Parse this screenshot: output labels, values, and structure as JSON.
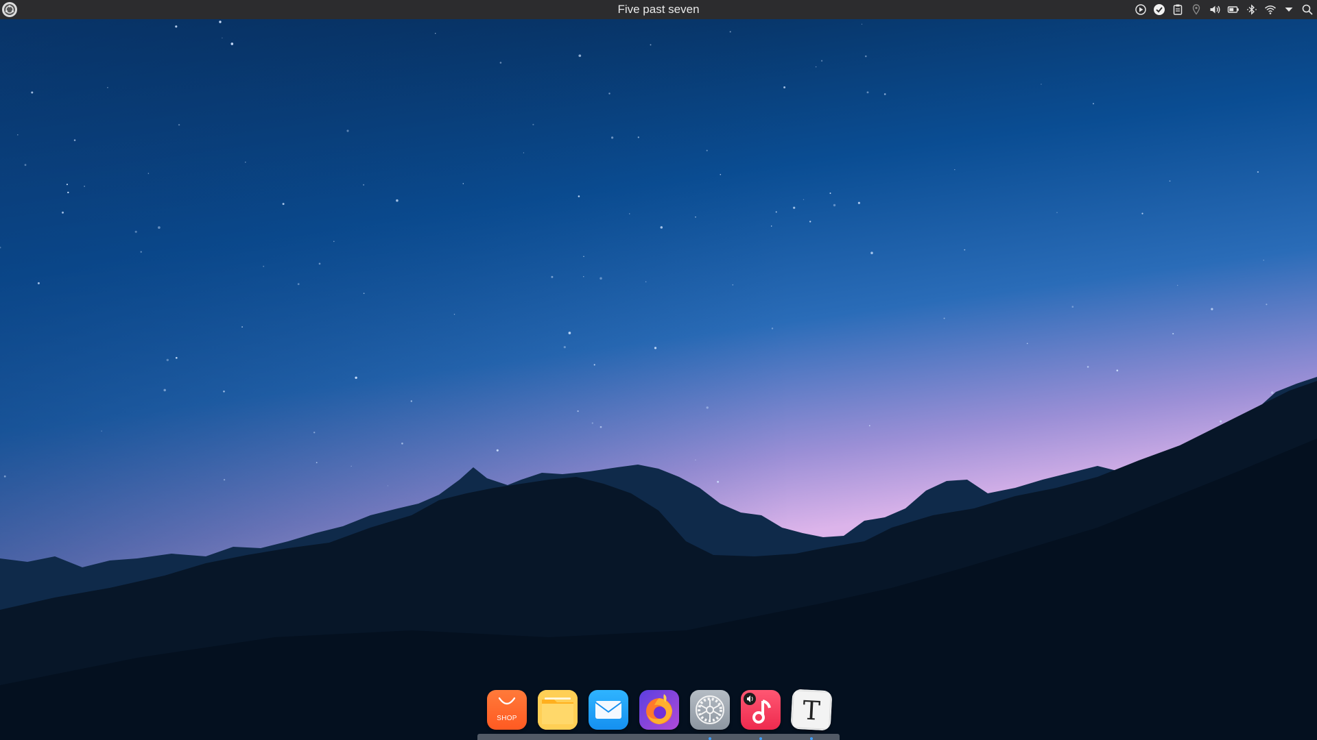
{
  "topbar": {
    "clock_text": "Five past seven",
    "menu_icon": "distro-logo-icon",
    "tray_icons": [
      "media-play-icon",
      "checkmark-icon",
      "clipboard-icon",
      "location-pin-icon",
      "volume-icon",
      "battery-icon",
      "bluetooth-icon",
      "wifi-icon",
      "dropdown-arrow-icon",
      "search-icon"
    ]
  },
  "dock": {
    "apps": [
      {
        "name": "app-store",
        "label": "SHOP",
        "icon": "shopping-bag-icon",
        "color": "#ff6b2e",
        "running": false
      },
      {
        "name": "files",
        "icon": "folder-icon",
        "color": "#ffc43d",
        "running": false
      },
      {
        "name": "mail",
        "icon": "envelope-icon",
        "color": "#1da1f2",
        "running": false
      },
      {
        "name": "firefox",
        "icon": "firefox-icon",
        "color": "#7b3fe4",
        "running": false
      },
      {
        "name": "settings",
        "icon": "gear-icon",
        "color": "#9aa3ad",
        "running": true
      },
      {
        "name": "music",
        "icon": "music-note-icon",
        "color": "#f23a5c",
        "running": true
      },
      {
        "name": "typora",
        "label": "T",
        "icon": "text-editor-icon",
        "color": "#f2f2f2",
        "running": true
      }
    ]
  },
  "colors": {
    "panel": "#2c2c2e",
    "sky_top": "#062a55",
    "sky_mid": "#0d5aa6",
    "horizon": "#d6b0e8",
    "mountains": "#061326",
    "indicator": "#3fa0ff"
  }
}
